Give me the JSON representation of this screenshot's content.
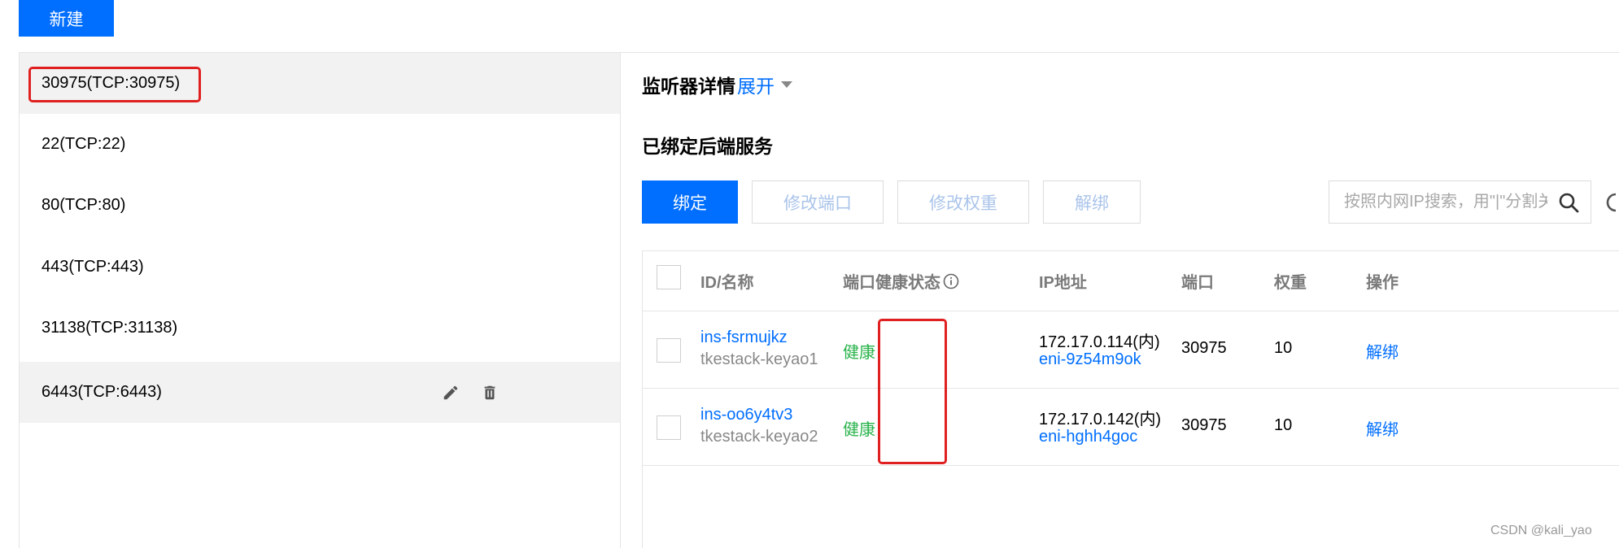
{
  "toolbar": {
    "new_label": "新建"
  },
  "listeners": [
    {
      "label": "30975(TCP:30975)"
    },
    {
      "label": "22(TCP:22)"
    },
    {
      "label": "80(TCP:80)"
    },
    {
      "label": "443(TCP:443)"
    },
    {
      "label": "31138(TCP:31138)"
    },
    {
      "label": "6443(TCP:6443)"
    }
  ],
  "detail": {
    "title": "监听器详情",
    "expand_label": "展开",
    "section_title": "已绑定后端服务",
    "buttons": {
      "bind": "绑定",
      "modify_port": "修改端口",
      "modify_weight": "修改权重",
      "unbind": "解绑"
    },
    "search_placeholder": "按照内网IP搜索，用\"|\"分割关键字"
  },
  "table": {
    "headers": {
      "id": "ID/名称",
      "health": "端口健康状态",
      "ip": "IP地址",
      "port": "端口",
      "weight": "权重",
      "action": "操作"
    },
    "rows": [
      {
        "id": "ins-fsrmujkz",
        "name": "tkestack-keyao1",
        "health": "健康",
        "ip": "172.17.0.114(内)",
        "eni": "eni-9z54m9ok",
        "port": "30975",
        "weight": "10",
        "action": "解绑"
      },
      {
        "id": "ins-oo6y4tv3",
        "name": "tkestack-keyao2",
        "health": "健康",
        "ip": "172.17.0.142(内)",
        "eni": "eni-hghh4goc",
        "port": "30975",
        "weight": "10",
        "action": "解绑"
      }
    ]
  },
  "watermark": "CSDN @kali_yao",
  "colors": {
    "primary": "#006eff",
    "healthy": "#29b34b",
    "highlight": "#e02020"
  }
}
